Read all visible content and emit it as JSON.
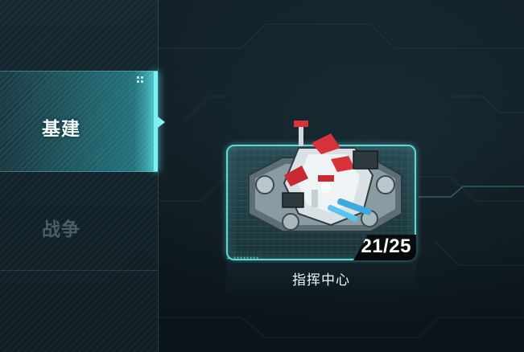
{
  "sidebar": {
    "tabs": [
      {
        "label": "基建",
        "active": true
      },
      {
        "label": "战争",
        "active": false
      }
    ]
  },
  "building_card": {
    "level_text": "21/25",
    "name": "指挥中心"
  },
  "colors": {
    "accent": "#5fd7d8",
    "active_tab_edge": "#7ff0f2",
    "inactive_text": "#4c5d63",
    "background": "#0f1a1f"
  }
}
